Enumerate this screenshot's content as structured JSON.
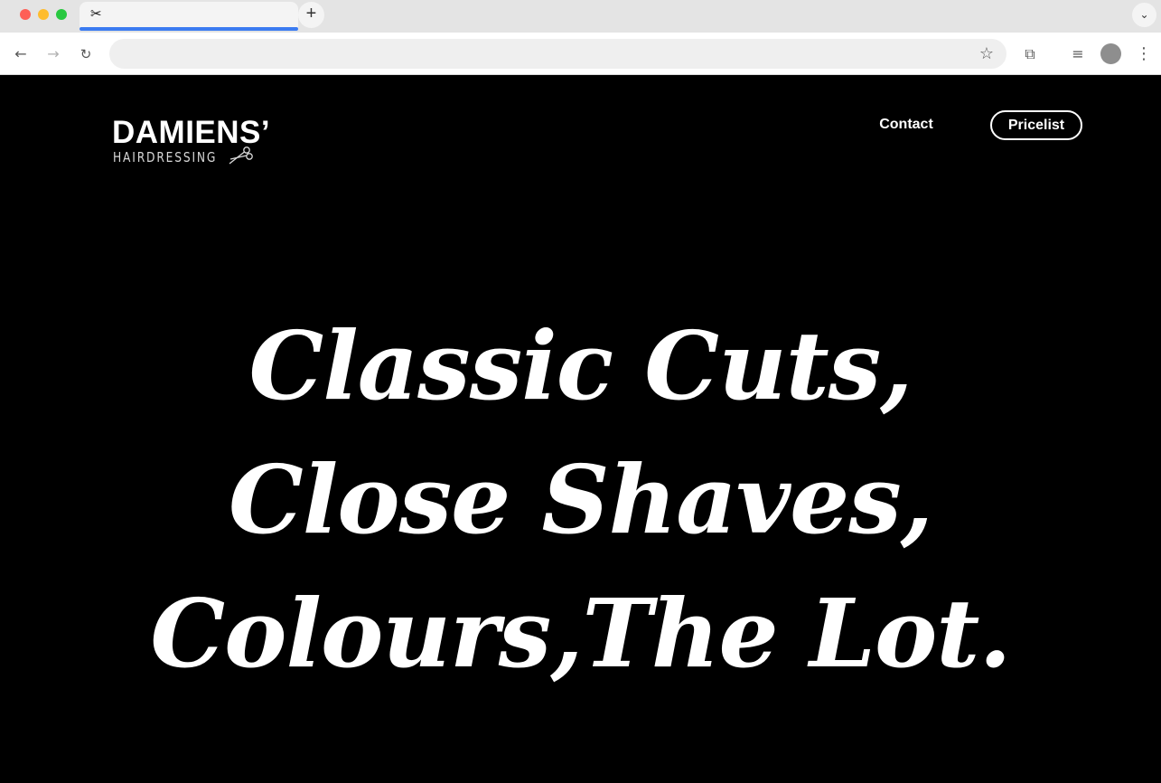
{
  "browser": {
    "tab": {
      "favicon_glyph": "✂",
      "title": ""
    },
    "new_tab_glyph": "+",
    "tab_menu_glyph": "⌄",
    "address_bar": {
      "value": "",
      "placeholder": ""
    },
    "icons": {
      "back": "←",
      "forward": "→",
      "reload": "↻",
      "star": "☆",
      "extensions": "⧉",
      "media": "≡",
      "more": "⋮"
    },
    "colors": {
      "tab_underline": "#3b7bf1",
      "close": "#fe5f57",
      "minimize": "#febc2e",
      "maximize": "#28c840"
    }
  },
  "site": {
    "logo": {
      "main": "DAMIENS’",
      "sub": "HAIRDRESSING"
    },
    "nav": {
      "contact": "Contact",
      "pricelist": "Pricelist"
    },
    "hero": {
      "line1": "Classic Cuts,",
      "line2": "Close Shaves,",
      "line3": "Colours,The Lot."
    },
    "colors": {
      "background": "#000000",
      "text": "#ffffff"
    }
  }
}
